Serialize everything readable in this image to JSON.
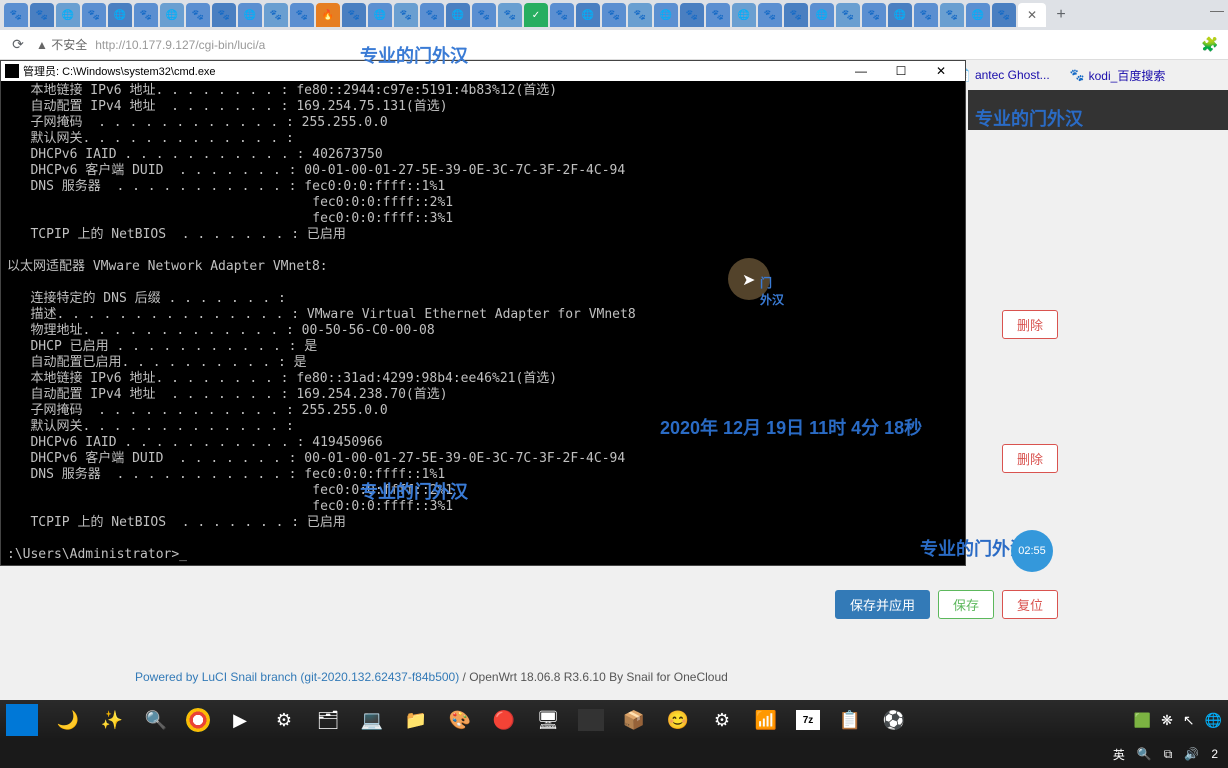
{
  "browser": {
    "url": "http://10.177.9.127/cgi-bin/luci/a",
    "insecure": "不安全",
    "bookmark1": "antec Ghost...",
    "bookmark2": "kodi_百度搜索"
  },
  "watermarks": {
    "text": "专业的门外汉",
    "timestamp": "2020年 12月 19日 11时 4分 18秒",
    "cursor_lbl": "门\n外汉"
  },
  "cmd": {
    "title": "管理员: C:\\Windows\\system32\\cmd.exe",
    "body": "   本地链接 IPv6 地址. . . . . . . . : fe80::2944:c97e:5191:4b83%12(首选)\n   自动配置 IPv4 地址  . . . . . . . : 169.254.75.131(首选)\n   子网掩码  . . . . . . . . . . . . : 255.255.0.0\n   默认网关. . . . . . . . . . . . . :\n   DHCPv6 IAID . . . . . . . . . . . : 402673750\n   DHCPv6 客户端 DUID  . . . . . . . : 00-01-00-01-27-5E-39-0E-3C-7C-3F-2F-4C-94\n   DNS 服务器  . . . . . . . . . . . : fec0:0:0:ffff::1%1\n                                       fec0:0:0:ffff::2%1\n                                       fec0:0:0:ffff::3%1\n   TCPIP 上的 NetBIOS  . . . . . . . : 已启用\n\n以太网适配器 VMware Network Adapter VMnet8:\n\n   连接特定的 DNS 后缀 . . . . . . . :\n   描述. . . . . . . . . . . . . . . : VMware Virtual Ethernet Adapter for VMnet8\n   物理地址. . . . . . . . . . . . . : 00-50-56-C0-00-08\n   DHCP 已启用 . . . . . . . . . . . : 是\n   自动配置已启用. . . . . . . . . . : 是\n   本地链接 IPv6 地址. . . . . . . . : fe80::31ad:4299:98b4:ee46%21(首选)\n   自动配置 IPv4 地址  . . . . . . . : 169.254.238.70(首选)\n   子网掩码  . . . . . . . . . . . . : 255.255.0.0\n   默认网关. . . . . . . . . . . . . :\n   DHCPv6 IAID . . . . . . . . . . . : 419450966\n   DHCPv6 客户端 DUID  . . . . . . . : 00-01-00-01-27-5E-39-0E-3C-7C-3F-2F-4C-94\n   DNS 服务器  . . . . . . . . . . . : fec0:0:0:ffff::1%1\n                                       fec0:0:0:ffff::2%1\n                                       fec0:0:0:ffff::3%1\n   TCPIP 上的 NetBIOS  . . . . . . . : 已启用\n\n:\\Users\\Administrator>_"
  },
  "luci": {
    "delete": "删除",
    "save_apply": "保存并应用",
    "save": "保存",
    "reset": "复位",
    "footer_link": "Powered by LuCI Snail branch (git-2020.132.62437-f84b500)",
    "footer_rest": " / OpenWrt 18.06.8 R3.6.10 By Snail for OneCloud"
  },
  "badge": {
    "time": "02:55"
  },
  "taskbar": {
    "ime": "英"
  }
}
